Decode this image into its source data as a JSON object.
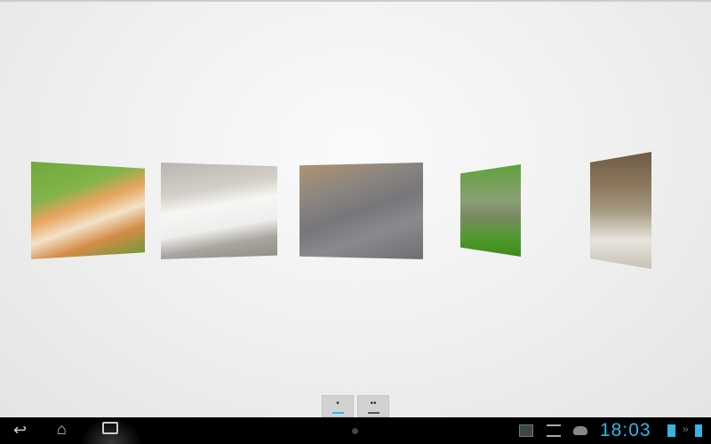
{
  "gallery": {
    "images": [
      {
        "subject": "Orange and white cat in grass"
      },
      {
        "subject": "White cat lying on pavement"
      },
      {
        "subject": "Grey Persian cat"
      },
      {
        "subject": "Two kittens in grass"
      },
      {
        "subject": "Tabby cat portrait"
      }
    ]
  },
  "pager": {
    "buttons": [
      {
        "label": "•",
        "active": true
      },
      {
        "label": "••",
        "active": false
      }
    ]
  },
  "colors": {
    "accent": "#33b5e5"
  },
  "navbar": {
    "back_icon": "back-icon",
    "home_icon": "home-icon",
    "recent_icon": "recent-apps-icon",
    "clock": "18:03"
  }
}
